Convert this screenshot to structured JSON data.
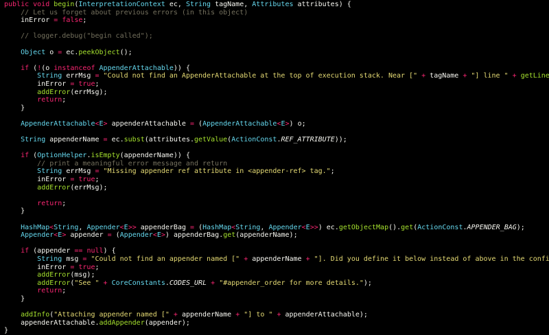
{
  "editor": {
    "lines": [
      [
        {
          "t": "public void ",
          "c": "kw"
        },
        {
          "t": "begin",
          "c": "fn"
        },
        {
          "t": "(",
          "c": "pl"
        },
        {
          "t": "InterpretationContext",
          "c": "ty"
        },
        {
          "t": " ec, ",
          "c": "pl"
        },
        {
          "t": "String",
          "c": "ty"
        },
        {
          "t": " tagName, ",
          "c": "pl"
        },
        {
          "t": "Attributes",
          "c": "ty"
        },
        {
          "t": " attributes) {",
          "c": "pl"
        }
      ],
      [
        {
          "t": "    // Let us forget about previous errors (in this object)",
          "c": "cm"
        }
      ],
      [
        {
          "t": "    inError ",
          "c": "pl"
        },
        {
          "t": "=",
          "c": "op"
        },
        {
          "t": " ",
          "c": "pl"
        },
        {
          "t": "false",
          "c": "kw"
        },
        {
          "t": ";",
          "c": "pl"
        }
      ],
      [
        {
          "t": "",
          "c": "pl"
        }
      ],
      [
        {
          "t": "    // logger.debug(\"begin called\");",
          "c": "cm"
        }
      ],
      [
        {
          "t": "",
          "c": "pl"
        }
      ],
      [
        {
          "t": "    ",
          "c": "pl"
        },
        {
          "t": "Object",
          "c": "ty"
        },
        {
          "t": " o ",
          "c": "pl"
        },
        {
          "t": "=",
          "c": "op"
        },
        {
          "t": " ec.",
          "c": "pl"
        },
        {
          "t": "peekObject",
          "c": "fn"
        },
        {
          "t": "();",
          "c": "pl"
        }
      ],
      [
        {
          "t": "",
          "c": "pl"
        }
      ],
      [
        {
          "t": "    ",
          "c": "pl"
        },
        {
          "t": "if",
          "c": "kw"
        },
        {
          "t": " (",
          "c": "pl"
        },
        {
          "t": "!",
          "c": "op"
        },
        {
          "t": "(o ",
          "c": "pl"
        },
        {
          "t": "instanceof",
          "c": "kw"
        },
        {
          "t": " ",
          "c": "pl"
        },
        {
          "t": "AppenderAttachable",
          "c": "ty"
        },
        {
          "t": ")) {",
          "c": "pl"
        }
      ],
      [
        {
          "t": "        ",
          "c": "pl"
        },
        {
          "t": "String",
          "c": "ty"
        },
        {
          "t": " errMsg ",
          "c": "pl"
        },
        {
          "t": "=",
          "c": "op"
        },
        {
          "t": " ",
          "c": "pl"
        },
        {
          "t": "\"Could not find an AppenderAttachable at the top of execution stack. Near [\"",
          "c": "str"
        },
        {
          "t": " ",
          "c": "pl"
        },
        {
          "t": "+",
          "c": "op"
        },
        {
          "t": " tagName ",
          "c": "pl"
        },
        {
          "t": "+",
          "c": "op"
        },
        {
          "t": " ",
          "c": "pl"
        },
        {
          "t": "\"] line \"",
          "c": "str"
        },
        {
          "t": " ",
          "c": "pl"
        },
        {
          "t": "+",
          "c": "op"
        },
        {
          "t": " ",
          "c": "pl"
        },
        {
          "t": "getLineNumber",
          "c": "fn"
        },
        {
          "t": "(ec);",
          "c": "pl"
        }
      ],
      [
        {
          "t": "        inError ",
          "c": "pl"
        },
        {
          "t": "=",
          "c": "op"
        },
        {
          "t": " ",
          "c": "pl"
        },
        {
          "t": "true",
          "c": "kw"
        },
        {
          "t": ";",
          "c": "pl"
        }
      ],
      [
        {
          "t": "        ",
          "c": "pl"
        },
        {
          "t": "addError",
          "c": "fn"
        },
        {
          "t": "(errMsg);",
          "c": "pl"
        }
      ],
      [
        {
          "t": "        ",
          "c": "pl"
        },
        {
          "t": "return",
          "c": "kw"
        },
        {
          "t": ";",
          "c": "pl"
        }
      ],
      [
        {
          "t": "    }",
          "c": "pl"
        }
      ],
      [
        {
          "t": "",
          "c": "pl"
        }
      ],
      [
        {
          "t": "    ",
          "c": "pl"
        },
        {
          "t": "AppenderAttachable",
          "c": "ty"
        },
        {
          "t": "<",
          "c": "op"
        },
        {
          "t": "E",
          "c": "ty"
        },
        {
          "t": ">",
          "c": "op"
        },
        {
          "t": " appenderAttachable ",
          "c": "pl"
        },
        {
          "t": "=",
          "c": "op"
        },
        {
          "t": " (",
          "c": "pl"
        },
        {
          "t": "AppenderAttachable",
          "c": "ty"
        },
        {
          "t": "<",
          "c": "op"
        },
        {
          "t": "E",
          "c": "ty"
        },
        {
          "t": ">",
          "c": "op"
        },
        {
          "t": ") o;",
          "c": "pl"
        }
      ],
      [
        {
          "t": "",
          "c": "pl"
        }
      ],
      [
        {
          "t": "    ",
          "c": "pl"
        },
        {
          "t": "String",
          "c": "ty"
        },
        {
          "t": " appenderName ",
          "c": "pl"
        },
        {
          "t": "=",
          "c": "op"
        },
        {
          "t": " ec.",
          "c": "pl"
        },
        {
          "t": "subst",
          "c": "fn"
        },
        {
          "t": "(attributes.",
          "c": "pl"
        },
        {
          "t": "getValue",
          "c": "fn"
        },
        {
          "t": "(",
          "c": "pl"
        },
        {
          "t": "ActionConst",
          "c": "ty"
        },
        {
          "t": ".",
          "c": "pl"
        },
        {
          "t": "REF_ATTRIBUTE",
          "c": "cst"
        },
        {
          "t": "));",
          "c": "pl"
        }
      ],
      [
        {
          "t": "",
          "c": "pl"
        }
      ],
      [
        {
          "t": "    ",
          "c": "pl"
        },
        {
          "t": "if",
          "c": "kw"
        },
        {
          "t": " (",
          "c": "pl"
        },
        {
          "t": "OptionHelper",
          "c": "ty"
        },
        {
          "t": ".",
          "c": "pl"
        },
        {
          "t": "isEmpty",
          "c": "fn"
        },
        {
          "t": "(appenderName)) {",
          "c": "pl"
        }
      ],
      [
        {
          "t": "        // print a meaningful error message and return",
          "c": "cm"
        }
      ],
      [
        {
          "t": "        ",
          "c": "pl"
        },
        {
          "t": "String",
          "c": "ty"
        },
        {
          "t": " errMsg ",
          "c": "pl"
        },
        {
          "t": "=",
          "c": "op"
        },
        {
          "t": " ",
          "c": "pl"
        },
        {
          "t": "\"Missing appender ref attribute in <appender-ref> tag.\"",
          "c": "str"
        },
        {
          "t": ";",
          "c": "pl"
        }
      ],
      [
        {
          "t": "        inError ",
          "c": "pl"
        },
        {
          "t": "=",
          "c": "op"
        },
        {
          "t": " ",
          "c": "pl"
        },
        {
          "t": "true",
          "c": "kw"
        },
        {
          "t": ";",
          "c": "pl"
        }
      ],
      [
        {
          "t": "        ",
          "c": "pl"
        },
        {
          "t": "addError",
          "c": "fn"
        },
        {
          "t": "(errMsg);",
          "c": "pl"
        }
      ],
      [
        {
          "t": "",
          "c": "pl"
        }
      ],
      [
        {
          "t": "        ",
          "c": "pl"
        },
        {
          "t": "return",
          "c": "kw"
        },
        {
          "t": ";",
          "c": "pl"
        }
      ],
      [
        {
          "t": "    }",
          "c": "pl"
        }
      ],
      [
        {
          "t": "",
          "c": "pl"
        }
      ],
      [
        {
          "t": "    ",
          "c": "pl"
        },
        {
          "t": "HashMap",
          "c": "ty"
        },
        {
          "t": "<",
          "c": "op"
        },
        {
          "t": "String",
          "c": "ty"
        },
        {
          "t": ", ",
          "c": "pl"
        },
        {
          "t": "Appender",
          "c": "ty"
        },
        {
          "t": "<",
          "c": "op"
        },
        {
          "t": "E",
          "c": "ty"
        },
        {
          "t": ">>",
          "c": "op"
        },
        {
          "t": " appenderBag ",
          "c": "pl"
        },
        {
          "t": "=",
          "c": "op"
        },
        {
          "t": " (",
          "c": "pl"
        },
        {
          "t": "HashMap",
          "c": "ty"
        },
        {
          "t": "<",
          "c": "op"
        },
        {
          "t": "String",
          "c": "ty"
        },
        {
          "t": ", ",
          "c": "pl"
        },
        {
          "t": "Appender",
          "c": "ty"
        },
        {
          "t": "<",
          "c": "op"
        },
        {
          "t": "E",
          "c": "ty"
        },
        {
          "t": ">>",
          "c": "op"
        },
        {
          "t": ") ec.",
          "c": "pl"
        },
        {
          "t": "getObjectMap",
          "c": "fn"
        },
        {
          "t": "().",
          "c": "pl"
        },
        {
          "t": "get",
          "c": "fn"
        },
        {
          "t": "(",
          "c": "pl"
        },
        {
          "t": "ActionConst",
          "c": "ty"
        },
        {
          "t": ".",
          "c": "pl"
        },
        {
          "t": "APPENDER_BAG",
          "c": "cst"
        },
        {
          "t": ");",
          "c": "pl"
        }
      ],
      [
        {
          "t": "    ",
          "c": "pl"
        },
        {
          "t": "Appender",
          "c": "ty"
        },
        {
          "t": "<",
          "c": "op"
        },
        {
          "t": "E",
          "c": "ty"
        },
        {
          "t": ">",
          "c": "op"
        },
        {
          "t": " appender ",
          "c": "pl"
        },
        {
          "t": "=",
          "c": "op"
        },
        {
          "t": " (",
          "c": "pl"
        },
        {
          "t": "Appender",
          "c": "ty"
        },
        {
          "t": "<",
          "c": "op"
        },
        {
          "t": "E",
          "c": "ty"
        },
        {
          "t": ">",
          "c": "op"
        },
        {
          "t": ") appenderBag.",
          "c": "pl"
        },
        {
          "t": "get",
          "c": "fn"
        },
        {
          "t": "(appenderName);",
          "c": "pl"
        }
      ],
      [
        {
          "t": "",
          "c": "pl"
        }
      ],
      [
        {
          "t": "    ",
          "c": "pl"
        },
        {
          "t": "if",
          "c": "kw"
        },
        {
          "t": " (appender ",
          "c": "pl"
        },
        {
          "t": "==",
          "c": "op"
        },
        {
          "t": " ",
          "c": "pl"
        },
        {
          "t": "null",
          "c": "kw"
        },
        {
          "t": ") {",
          "c": "pl"
        }
      ],
      [
        {
          "t": "        ",
          "c": "pl"
        },
        {
          "t": "String",
          "c": "ty"
        },
        {
          "t": " msg ",
          "c": "pl"
        },
        {
          "t": "=",
          "c": "op"
        },
        {
          "t": " ",
          "c": "pl"
        },
        {
          "t": "\"Could not find an appender named [\"",
          "c": "str"
        },
        {
          "t": " ",
          "c": "pl"
        },
        {
          "t": "+",
          "c": "op"
        },
        {
          "t": " appenderName ",
          "c": "pl"
        },
        {
          "t": "+",
          "c": "op"
        },
        {
          "t": " ",
          "c": "pl"
        },
        {
          "t": "\"]. Did you define it below instead of above in the configuration file?\"",
          "c": "str"
        },
        {
          "t": ";",
          "c": "pl"
        }
      ],
      [
        {
          "t": "        inError ",
          "c": "pl"
        },
        {
          "t": "=",
          "c": "op"
        },
        {
          "t": " ",
          "c": "pl"
        },
        {
          "t": "true",
          "c": "kw"
        },
        {
          "t": ";",
          "c": "pl"
        }
      ],
      [
        {
          "t": "        ",
          "c": "pl"
        },
        {
          "t": "addError",
          "c": "fn"
        },
        {
          "t": "(msg);",
          "c": "pl"
        }
      ],
      [
        {
          "t": "        ",
          "c": "pl"
        },
        {
          "t": "addError",
          "c": "fn"
        },
        {
          "t": "(",
          "c": "pl"
        },
        {
          "t": "\"See \"",
          "c": "str"
        },
        {
          "t": " ",
          "c": "pl"
        },
        {
          "t": "+",
          "c": "op"
        },
        {
          "t": " ",
          "c": "pl"
        },
        {
          "t": "CoreConstants",
          "c": "ty"
        },
        {
          "t": ".",
          "c": "pl"
        },
        {
          "t": "CODES_URL",
          "c": "cst"
        },
        {
          "t": " ",
          "c": "pl"
        },
        {
          "t": "+",
          "c": "op"
        },
        {
          "t": " ",
          "c": "pl"
        },
        {
          "t": "\"#appender_order for more details.\"",
          "c": "str"
        },
        {
          "t": ");",
          "c": "pl"
        }
      ],
      [
        {
          "t": "        ",
          "c": "pl"
        },
        {
          "t": "return",
          "c": "kw"
        },
        {
          "t": ";",
          "c": "pl"
        }
      ],
      [
        {
          "t": "    }",
          "c": "pl"
        }
      ],
      [
        {
          "t": "",
          "c": "pl"
        }
      ],
      [
        {
          "t": "    ",
          "c": "pl"
        },
        {
          "t": "addInfo",
          "c": "fn"
        },
        {
          "t": "(",
          "c": "pl"
        },
        {
          "t": "\"Attaching appender named [\"",
          "c": "str"
        },
        {
          "t": " ",
          "c": "pl"
        },
        {
          "t": "+",
          "c": "op"
        },
        {
          "t": " appenderName ",
          "c": "pl"
        },
        {
          "t": "+",
          "c": "op"
        },
        {
          "t": " ",
          "c": "pl"
        },
        {
          "t": "\"] to \"",
          "c": "str"
        },
        {
          "t": " ",
          "c": "pl"
        },
        {
          "t": "+",
          "c": "op"
        },
        {
          "t": " appenderAttachable);",
          "c": "pl"
        }
      ],
      [
        {
          "t": "    appenderAttachable.",
          "c": "pl"
        },
        {
          "t": "addAppender",
          "c": "fn"
        },
        {
          "t": "(appender);",
          "c": "pl"
        }
      ],
      [
        {
          "t": "}",
          "c": "pl"
        }
      ]
    ]
  }
}
